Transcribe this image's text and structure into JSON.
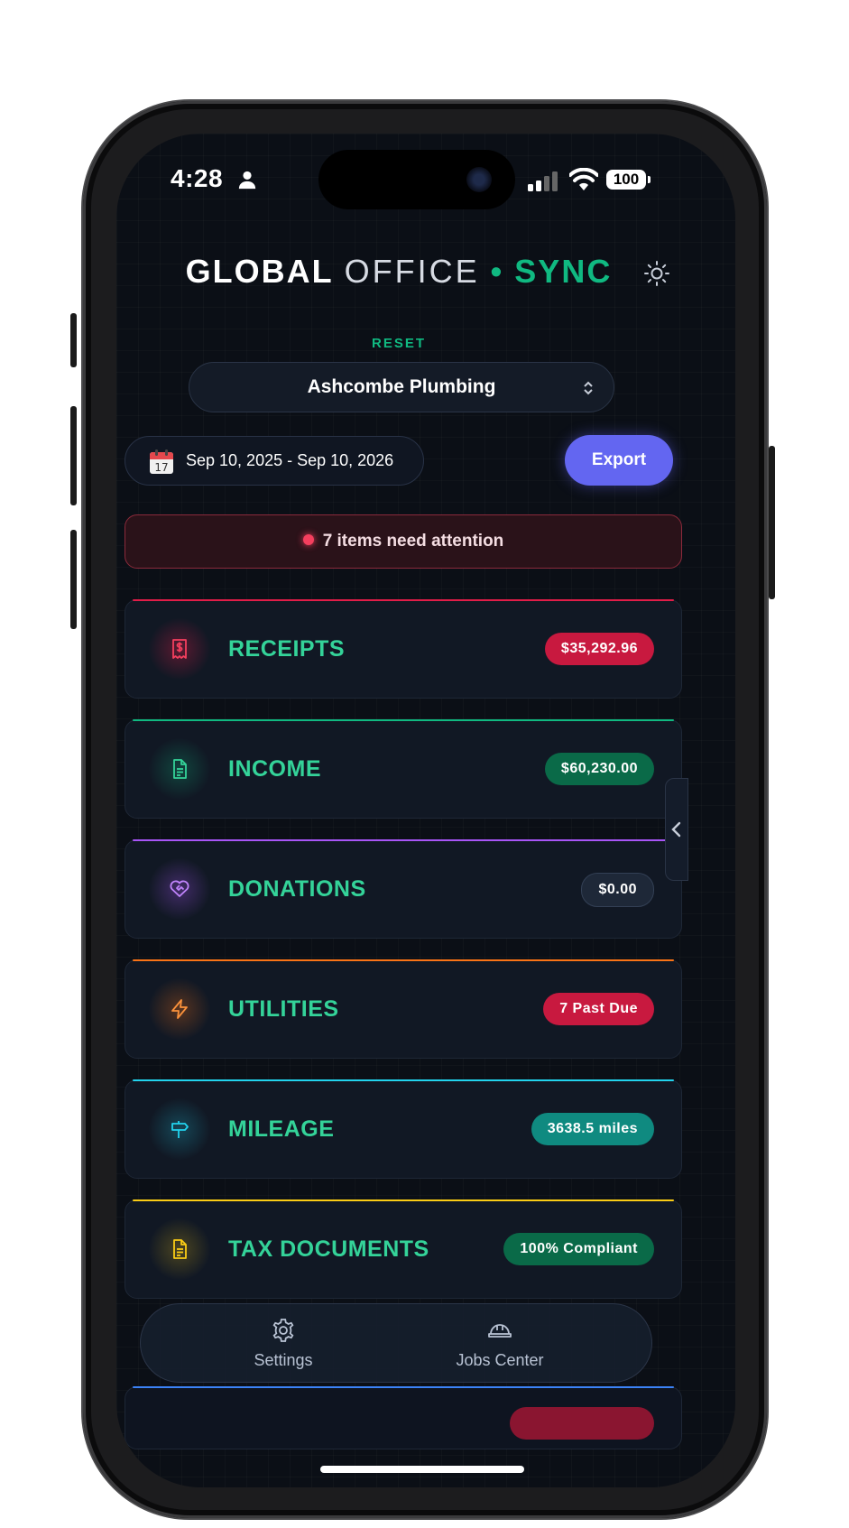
{
  "status_bar": {
    "time": "4:28",
    "battery": "100"
  },
  "app": {
    "title_bold": "GLOBAL",
    "title_light": "OFFICE",
    "title_sep": "•",
    "title_accent": "SYNC",
    "reset_label": "RESET",
    "company": "Ashcombe Plumbing",
    "date_range": "Sep 10, 2025 - Sep 10, 2026",
    "calendar_day": "17",
    "export_label": "Export",
    "alert_text": "7 items need attention"
  },
  "cards": [
    {
      "label": "RECEIPTS",
      "badge": "$35,292.96",
      "icon": "receipt-icon"
    },
    {
      "label": "INCOME",
      "badge": "$60,230.00",
      "icon": "document-icon"
    },
    {
      "label": "DONATIONS",
      "badge": "$0.00",
      "icon": "heart-handshake-icon"
    },
    {
      "label": "UTILITIES",
      "badge": "7 Past Due",
      "icon": "lightning-icon"
    },
    {
      "label": "MILEAGE",
      "badge": "3638.5 miles",
      "icon": "signpost-icon"
    },
    {
      "label": "TAX DOCUMENTS",
      "badge": "100% Compliant",
      "icon": "tax-document-icon"
    }
  ],
  "colors": {
    "accent_green": "#10b981",
    "receipts": "#e11d48",
    "income": "#10b981",
    "donations": "#a855f7",
    "utilities": "#f97316",
    "mileage": "#22d3ee",
    "tax_documents": "#facc15",
    "export": "#6366f1"
  },
  "bottom_nav": [
    {
      "label": "Settings",
      "icon": "gear-icon"
    },
    {
      "label": "Jobs Center",
      "icon": "hard-hat-icon"
    }
  ]
}
